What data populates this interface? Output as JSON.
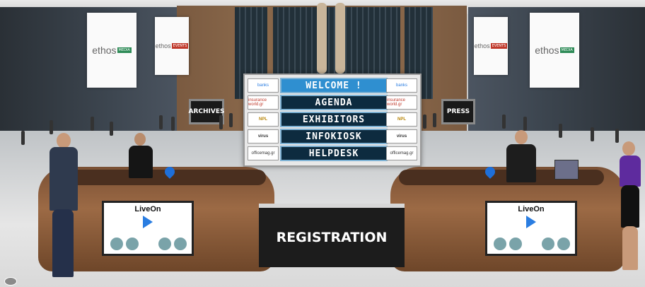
{
  "banners": {
    "left_large": {
      "brand": "ethos",
      "tag": "MEDIA"
    },
    "left_small": {
      "brand": "ethos",
      "tag": "EVENTS"
    },
    "right_small": {
      "brand": "ethos",
      "tag": "EVENTS"
    },
    "right_large": {
      "brand": "ethos",
      "tag": "MEDIA"
    }
  },
  "signs": {
    "archives": "ARCHIVES",
    "press": "PRESS"
  },
  "menu": [
    {
      "label": "WELCOME !"
    },
    {
      "label": "AGENDA"
    },
    {
      "label": "EXHIBITORS"
    },
    {
      "label": "INFOKIOSK"
    },
    {
      "label": "HELPDESK"
    }
  ],
  "sponsors": [
    "banks",
    "insurance world.gr",
    "NPL",
    "virus",
    "officemag.gr"
  ],
  "screens": {
    "left": {
      "title": "LiveOn"
    },
    "right": {
      "title": "LiveOn"
    }
  },
  "registration": {
    "label": "REGISTRATION"
  },
  "colors": {
    "menu_bg": "#0d2b3f",
    "menu_active": "#2f8fd0",
    "pin": "#1e6fd9"
  },
  "icons": {
    "view_toggle": "eye-icon",
    "location_pin": "map-pin-icon"
  }
}
